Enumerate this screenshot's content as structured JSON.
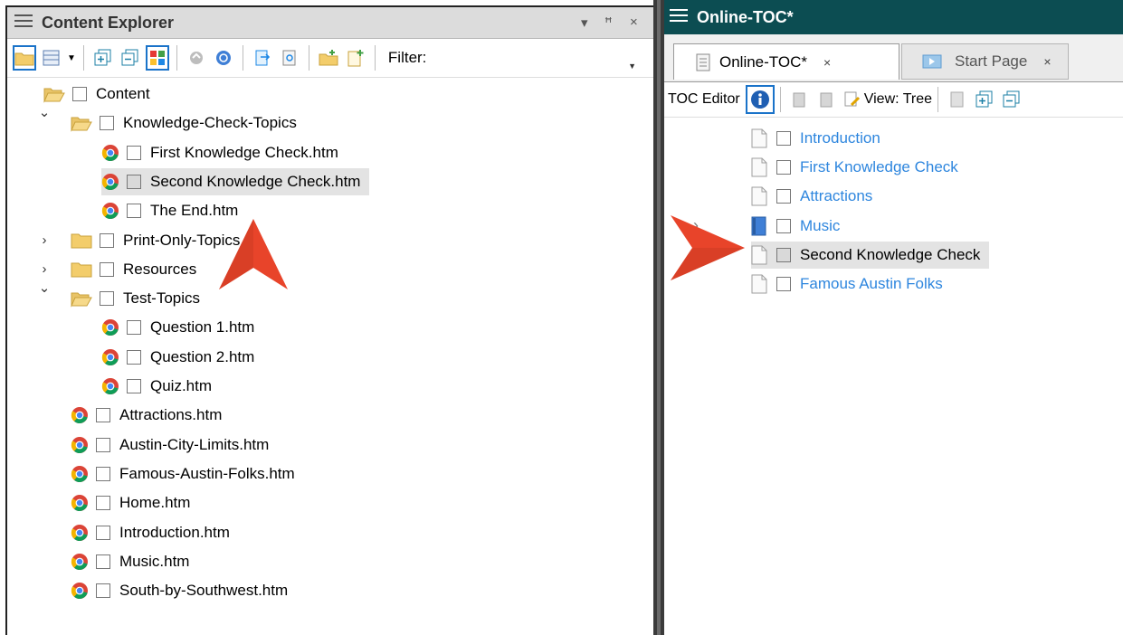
{
  "content_explorer": {
    "title": "Content Explorer",
    "filter_label": "Filter:",
    "window_controls": {
      "dropdown": "▾",
      "pin": "ꟸ",
      "close": "×"
    },
    "tree": [
      {
        "label": "Content",
        "level": 0,
        "icon": "folder-open-icon",
        "expander": ""
      },
      {
        "label": "Knowledge-Check-Topics",
        "level": 1,
        "icon": "folder-open-icon",
        "expander": "expanded"
      },
      {
        "label": "First Knowledge Check.htm",
        "level": 2,
        "icon": "chrome-icon",
        "expander": ""
      },
      {
        "label": "Second Knowledge Check.htm",
        "level": 2,
        "icon": "chrome-icon",
        "expander": "",
        "selected": true
      },
      {
        "label": "The End.htm",
        "level": 2,
        "icon": "chrome-icon",
        "expander": ""
      },
      {
        "label": "Print-Only-Topics",
        "level": 1,
        "icon": "folder-icon",
        "expander": "collapsed"
      },
      {
        "label": "Resources",
        "level": 1,
        "icon": "folder-icon",
        "expander": "collapsed"
      },
      {
        "label": "Test-Topics",
        "level": 1,
        "icon": "folder-open-icon",
        "expander": "expanded"
      },
      {
        "label": "Question 1.htm",
        "level": 2,
        "icon": "chrome-icon",
        "expander": ""
      },
      {
        "label": "Question 2.htm",
        "level": 2,
        "icon": "chrome-icon",
        "expander": ""
      },
      {
        "label": "Quiz.htm",
        "level": 2,
        "icon": "chrome-icon",
        "expander": ""
      },
      {
        "label": "Attractions.htm",
        "level": 1,
        "icon": "chrome-icon",
        "expander": ""
      },
      {
        "label": "Austin-City-Limits.htm",
        "level": 1,
        "icon": "chrome-icon",
        "expander": ""
      },
      {
        "label": "Famous-Austin-Folks.htm",
        "level": 1,
        "icon": "chrome-icon",
        "expander": ""
      },
      {
        "label": "Home.htm",
        "level": 1,
        "icon": "chrome-icon",
        "expander": ""
      },
      {
        "label": "Introduction.htm",
        "level": 1,
        "icon": "chrome-icon",
        "expander": ""
      },
      {
        "label": "Music.htm",
        "level": 1,
        "icon": "chrome-icon",
        "expander": ""
      },
      {
        "label": "South-by-Southwest.htm",
        "level": 1,
        "icon": "chrome-icon",
        "expander": ""
      }
    ]
  },
  "toc_window": {
    "title": "Online-TOC*",
    "tabs": [
      {
        "label": "Online-TOC*",
        "close": "×",
        "active": true
      },
      {
        "label": "Start Page",
        "close": "×",
        "active": false
      }
    ],
    "toolbar": {
      "toc_editor_label": "TOC Editor",
      "view_label": "View: Tree"
    },
    "entries": [
      {
        "label": "Introduction",
        "icon": "page-icon",
        "link": true
      },
      {
        "label": "First Knowledge Check",
        "icon": "page-icon",
        "link": true
      },
      {
        "label": "Attractions",
        "icon": "page-icon",
        "link": true
      },
      {
        "label": "Music",
        "icon": "book-icon",
        "link": true,
        "expander": "collapsed"
      },
      {
        "label": "Second Knowledge Check",
        "icon": "page-icon",
        "link": false,
        "selected": true
      },
      {
        "label": "Famous Austin Folks",
        "icon": "page-icon",
        "link": true
      }
    ]
  },
  "colors": {
    "accent": "#1a73c9",
    "link": "#2e86de",
    "titlebar_dark": "#0c4d52",
    "pointer": "#e8442a"
  }
}
